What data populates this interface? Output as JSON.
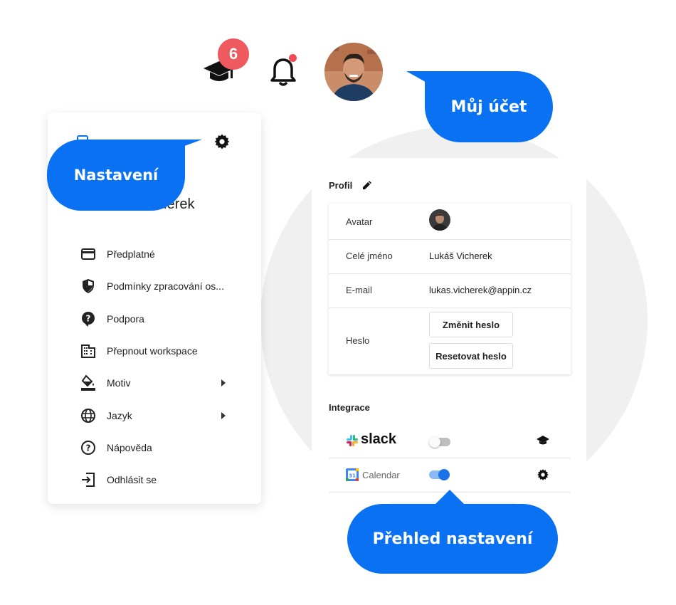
{
  "top_bar": {
    "badge_count": "6",
    "icons": [
      "graduation-cap-icon",
      "bell-icon",
      "avatar"
    ]
  },
  "menu": {
    "user_name": "Vicherek",
    "items": [
      {
        "label": "Předplatné",
        "icon": "credit-card-icon"
      },
      {
        "label": "Podmínky zpracování os...",
        "icon": "shield-icon"
      },
      {
        "label": "Podpora",
        "icon": "help-circle-icon"
      },
      {
        "label": "Přepnout workspace",
        "icon": "building-icon"
      },
      {
        "label": "Motiv",
        "icon": "paint-bucket-icon",
        "has_submenu": true
      },
      {
        "label": "Jazyk",
        "icon": "globe-icon",
        "has_submenu": true
      },
      {
        "label": "Nápověda",
        "icon": "question-icon"
      },
      {
        "label": "Odhlásit se",
        "icon": "logout-icon"
      }
    ]
  },
  "bubbles": {
    "nastaveni": "Nastavení",
    "muj_ucet": "Můj účet",
    "prehled": "Přehled nastavení"
  },
  "settings": {
    "profile_title": "Profil",
    "rows": {
      "avatar_label": "Avatar",
      "name_label": "Celé jméno",
      "name_value": "Lukáš Vicherek",
      "email_label": "E-mail",
      "email_value": "lukas.vicherek@appin.cz",
      "password_label": "Heslo",
      "change_password": "Změnit heslo",
      "reset_password": "Resetovat heslo"
    },
    "integrations_title": "Integrace",
    "integrations": [
      {
        "name": "slack",
        "enabled": false,
        "action_icon": "graduation-cap-icon"
      },
      {
        "name": "Calendar",
        "enabled": true,
        "action_icon": "gear-icon"
      }
    ]
  },
  "colors": {
    "accent": "#0a72f2",
    "badge": "#ef5a5f",
    "circle_bg": "#f0f0f0"
  }
}
